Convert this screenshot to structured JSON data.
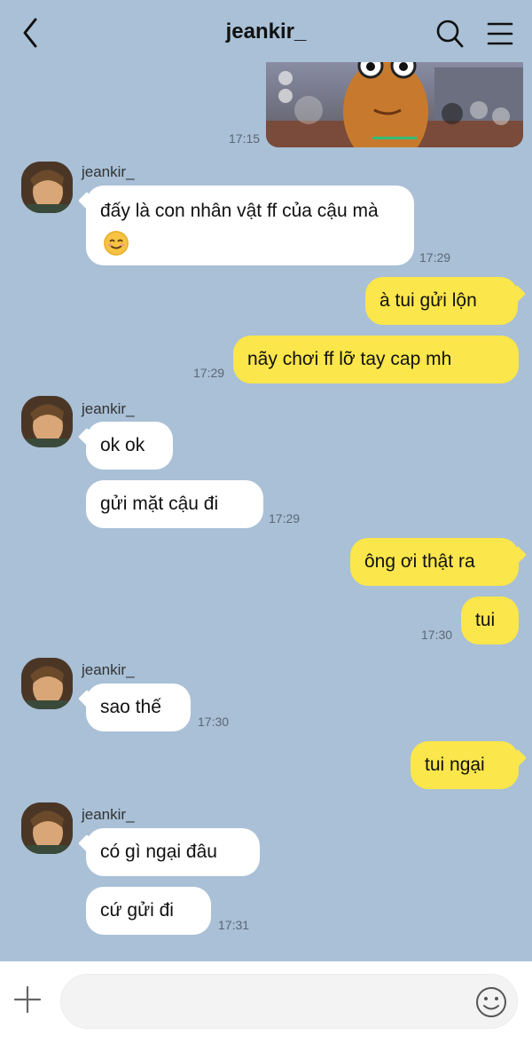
{
  "header": {
    "title": "jeankir_",
    "back_icon": "chevron-left-icon",
    "search_icon": "search-icon",
    "menu_icon": "hamburger-menu-icon"
  },
  "messages": {
    "photo_time": "17:15",
    "group1": {
      "sender": "jeankir_",
      "text": "đấy là con nhân vật ff của cậu mà",
      "emoji": "smiling-face-emoji",
      "time": "17:29"
    },
    "out1": {
      "text1": "à tui gửi lộn",
      "text2": "nãy chơi ff lỡ tay cap mh",
      "time": "17:29"
    },
    "group2": {
      "sender": "jeankir_",
      "text1": "ok ok",
      "text2": "gửi mặt cậu đi",
      "time": "17:29"
    },
    "out2": {
      "text1": "ông ơi thật ra",
      "text2": "tui",
      "time": "17:30"
    },
    "group3": {
      "sender": "jeankir_",
      "text1": "sao thế",
      "time": "17:30"
    },
    "out3": {
      "text1": "tui ngại"
    },
    "group4": {
      "sender": "jeankir_",
      "text1": "có gì ngại đâu",
      "text2": "cứ gửi đi",
      "time": "17:31"
    }
  },
  "input_bar": {
    "placeholder": "",
    "plus_icon": "plus-icon",
    "emoji_icon": "smiley-icon"
  },
  "colors": {
    "background": "#a9c0d6",
    "outgoing_bubble": "#fbe64b",
    "incoming_bubble": "#ffffff"
  }
}
